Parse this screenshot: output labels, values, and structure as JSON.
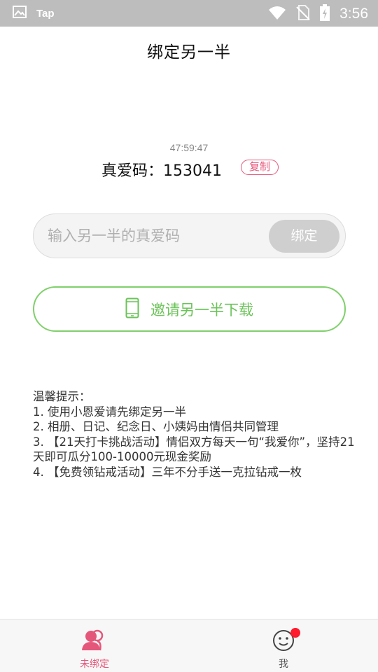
{
  "status_bar": {
    "app_name": "Tap",
    "time": "3:56",
    "icons": [
      "image-icon",
      "wifi-icon",
      "no-sim-icon",
      "battery-charging-icon"
    ]
  },
  "header": {
    "title": "绑定另一半"
  },
  "love_code": {
    "countdown": "47:59:47",
    "text": "真爱码：153041",
    "copy_label": "复制"
  },
  "bind_form": {
    "placeholder": "输入另一半的真爱码",
    "value": "",
    "bind_label": "绑定"
  },
  "invite": {
    "label": "邀请另一半下载",
    "icon": "phone-icon"
  },
  "tips": {
    "title": "温馨提示：",
    "lines": [
      "1. 使用小恩爱请先绑定另一半",
      "2. 相册、日记、纪念日、小姨妈由情侣共同管理",
      "3. 【21天打卡挑战活动】情侣双方每天一句“我爱你”，坚持21天即可瓜分100-10000元现金奖励",
      "4. 【免费领钻戒活动】三年不分手送一克拉钻戒一枚"
    ]
  },
  "bottom_nav": {
    "items": [
      {
        "label": "未绑定",
        "icon": "couple-icon",
        "active": true
      },
      {
        "label": "我",
        "icon": "smiley-icon",
        "active": false,
        "has_badge": true
      }
    ]
  },
  "colors": {
    "accent_pink": "#e5577a",
    "accent_green": "#6cc35a",
    "status_bar": "#bdbdbd",
    "badge_red": "#ff1a2e"
  }
}
